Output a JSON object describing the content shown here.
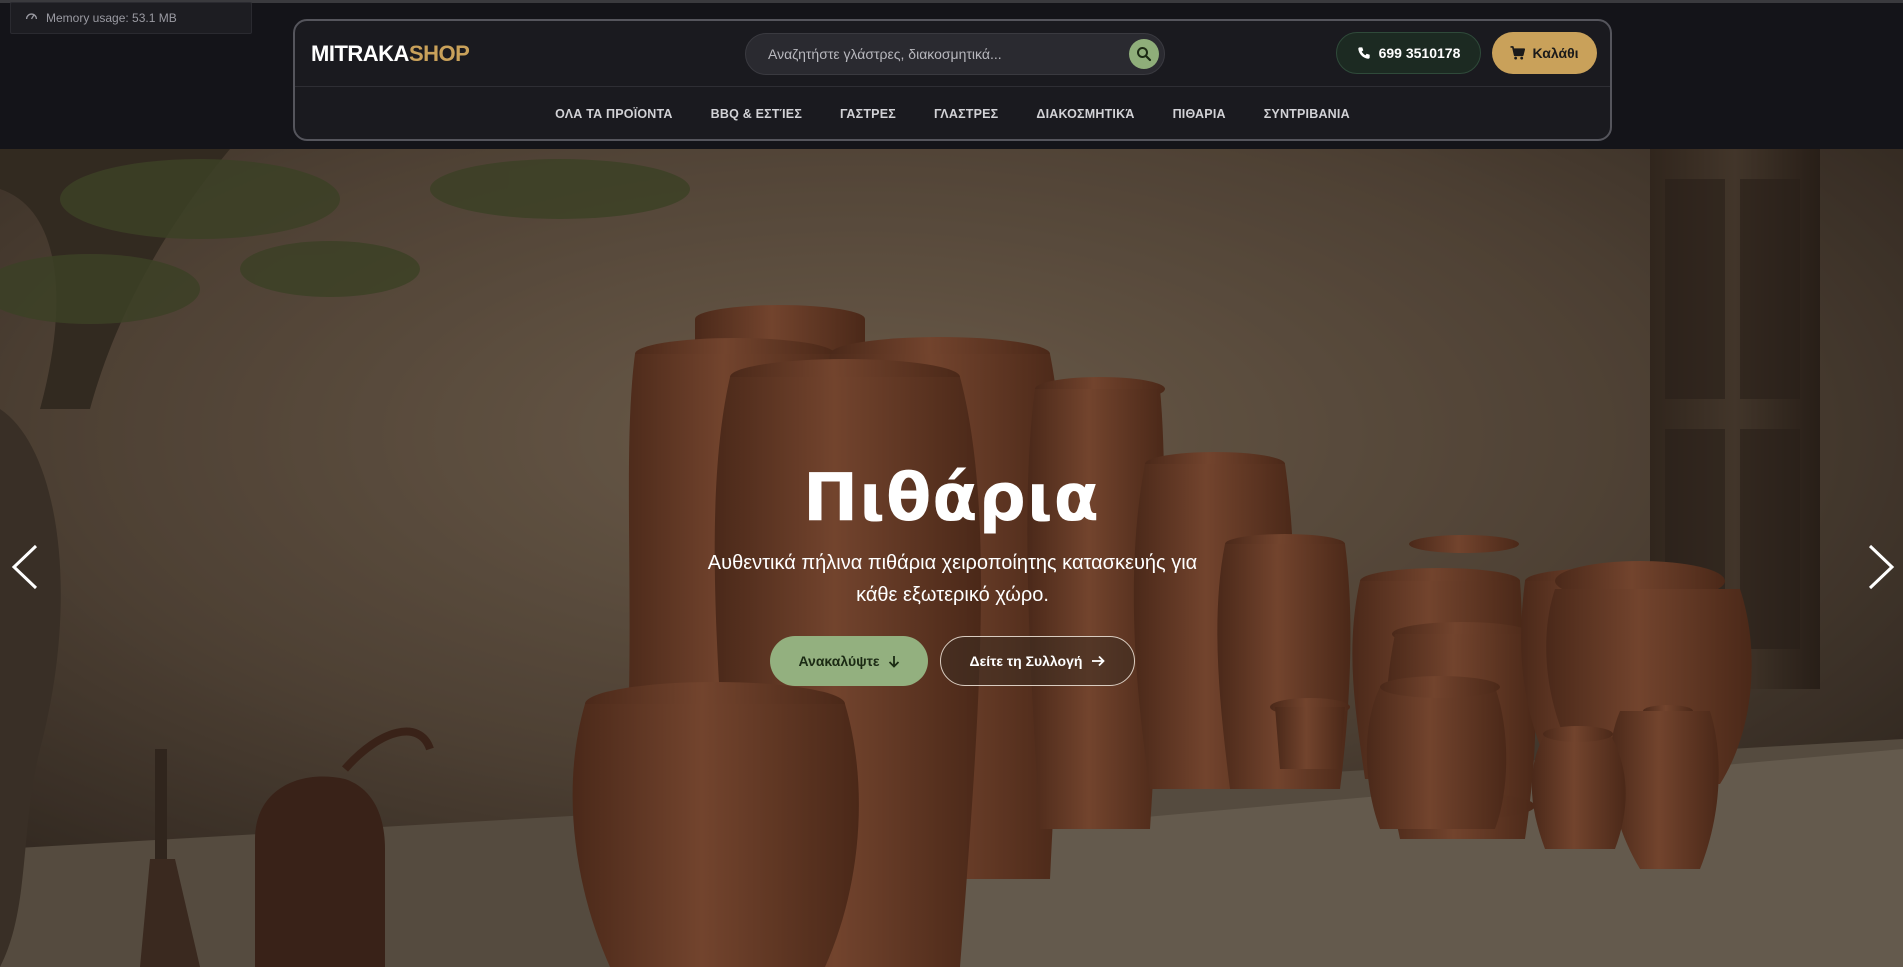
{
  "memory": {
    "label": "Memory usage: 53.1 MB"
  },
  "header": {
    "logo_primary": "MITRAKA",
    "logo_secondary": "SHOP",
    "search_placeholder": "Αναζητήστε γλάστρες, διακοσμητικά...",
    "phone": "699 3510178",
    "cart_label": "Καλάθι"
  },
  "nav": {
    "items": [
      "ΟΛΑ ΤΑ ΠΡΟΪΟΝΤΑ",
      "BBQ & ΕΣΤΊΕΣ",
      "ΓΑΣΤΡΕΣ",
      "ΓΛΑΣΤΡΕΣ",
      "ΔΙΑΚΟΣΜΗΤΙΚΆ",
      "ΠΙΘΑΡΙΑ",
      "ΣΥΝΤΡΙΒΑΝΙΑ"
    ]
  },
  "hero": {
    "title": "Πιθάρια",
    "subtitle": "Αυθεντικά πήλινα πιθάρια χειροποίητης κατασκευής για κάθε εξωτερικό χώρο.",
    "primary_button": "Ανακαλύψτε",
    "secondary_button": "Δείτε τη Συλλογή"
  },
  "colors": {
    "accent_gold": "#c9a15a",
    "accent_green": "#93b07f",
    "background": "#141419"
  },
  "icons": {
    "memory": "gauge-icon",
    "search": "search-icon",
    "phone": "phone-icon",
    "cart": "cart-icon",
    "discover": "arrow-down-icon",
    "collection": "arrow-right-icon",
    "prev": "chevron-left-icon",
    "next": "chevron-right-icon"
  }
}
